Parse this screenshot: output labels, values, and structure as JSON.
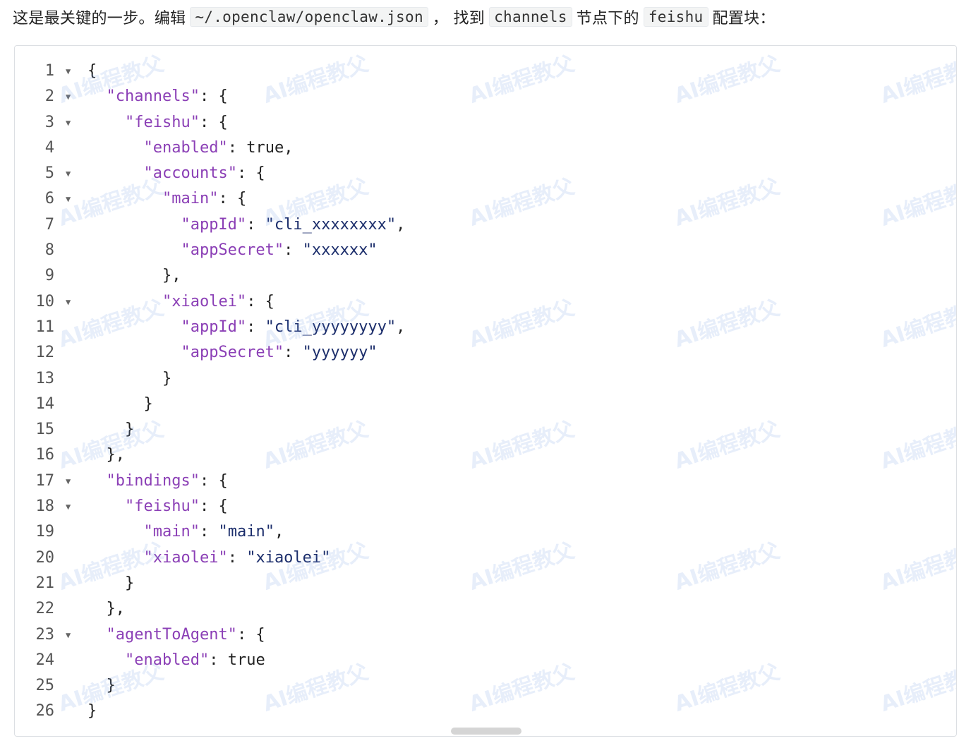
{
  "intro": {
    "before": "这是最关键的一步。编辑",
    "file_path": "~/.openclaw/openclaw.json",
    "middle": "， 找到",
    "channels_word": "channels",
    "middle2": "节点下的",
    "feishu_word": "feishu",
    "after": "配置块："
  },
  "watermark_text": "AI编程教父",
  "code_lines": [
    {
      "num": "1",
      "fold": true,
      "indent": 0,
      "tokens": [
        {
          "t": "punc",
          "v": "{"
        }
      ]
    },
    {
      "num": "2",
      "fold": true,
      "indent": 1,
      "tokens": [
        {
          "t": "key",
          "v": "\"channels\""
        },
        {
          "t": "punc",
          "v": ": {"
        }
      ]
    },
    {
      "num": "3",
      "fold": true,
      "indent": 2,
      "tokens": [
        {
          "t": "key",
          "v": "\"feishu\""
        },
        {
          "t": "punc",
          "v": ": {"
        }
      ]
    },
    {
      "num": "4",
      "fold": false,
      "indent": 3,
      "tokens": [
        {
          "t": "key",
          "v": "\"enabled\""
        },
        {
          "t": "punc",
          "v": ": "
        },
        {
          "t": "lit",
          "v": "true"
        },
        {
          "t": "punc",
          "v": ","
        }
      ]
    },
    {
      "num": "5",
      "fold": true,
      "indent": 3,
      "tokens": [
        {
          "t": "key",
          "v": "\"accounts\""
        },
        {
          "t": "punc",
          "v": ": {"
        }
      ]
    },
    {
      "num": "6",
      "fold": true,
      "indent": 4,
      "tokens": [
        {
          "t": "key",
          "v": "\"main\""
        },
        {
          "t": "punc",
          "v": ": {"
        }
      ]
    },
    {
      "num": "7",
      "fold": false,
      "indent": 5,
      "tokens": [
        {
          "t": "key",
          "v": "\"appId\""
        },
        {
          "t": "punc",
          "v": ": "
        },
        {
          "t": "str",
          "v": "\"cli_xxxxxxxx\""
        },
        {
          "t": "punc",
          "v": ","
        }
      ]
    },
    {
      "num": "8",
      "fold": false,
      "indent": 5,
      "tokens": [
        {
          "t": "key",
          "v": "\"appSecret\""
        },
        {
          "t": "punc",
          "v": ": "
        },
        {
          "t": "str",
          "v": "\"xxxxxx\""
        }
      ]
    },
    {
      "num": "9",
      "fold": false,
      "indent": 4,
      "tokens": [
        {
          "t": "punc",
          "v": "},"
        }
      ]
    },
    {
      "num": "10",
      "fold": true,
      "indent": 4,
      "tokens": [
        {
          "t": "key",
          "v": "\"xiaolei\""
        },
        {
          "t": "punc",
          "v": ": {"
        }
      ]
    },
    {
      "num": "11",
      "fold": false,
      "indent": 5,
      "tokens": [
        {
          "t": "key",
          "v": "\"appId\""
        },
        {
          "t": "punc",
          "v": ": "
        },
        {
          "t": "str",
          "v": "\"cli_yyyyyyyy\""
        },
        {
          "t": "punc",
          "v": ","
        }
      ]
    },
    {
      "num": "12",
      "fold": false,
      "indent": 5,
      "tokens": [
        {
          "t": "key",
          "v": "\"appSecret\""
        },
        {
          "t": "punc",
          "v": ": "
        },
        {
          "t": "str",
          "v": "\"yyyyyy\""
        }
      ]
    },
    {
      "num": "13",
      "fold": false,
      "indent": 4,
      "tokens": [
        {
          "t": "punc",
          "v": "}"
        }
      ]
    },
    {
      "num": "14",
      "fold": false,
      "indent": 3,
      "tokens": [
        {
          "t": "punc",
          "v": "}"
        }
      ]
    },
    {
      "num": "15",
      "fold": false,
      "indent": 2,
      "tokens": [
        {
          "t": "punc",
          "v": "}"
        }
      ]
    },
    {
      "num": "16",
      "fold": false,
      "indent": 1,
      "tokens": [
        {
          "t": "punc",
          "v": "},"
        }
      ]
    },
    {
      "num": "17",
      "fold": true,
      "indent": 1,
      "tokens": [
        {
          "t": "key",
          "v": "\"bindings\""
        },
        {
          "t": "punc",
          "v": ": {"
        }
      ]
    },
    {
      "num": "18",
      "fold": true,
      "indent": 2,
      "tokens": [
        {
          "t": "key",
          "v": "\"feishu\""
        },
        {
          "t": "punc",
          "v": ": {"
        }
      ]
    },
    {
      "num": "19",
      "fold": false,
      "indent": 3,
      "tokens": [
        {
          "t": "key",
          "v": "\"main\""
        },
        {
          "t": "punc",
          "v": ": "
        },
        {
          "t": "str",
          "v": "\"main\""
        },
        {
          "t": "punc",
          "v": ","
        }
      ]
    },
    {
      "num": "20",
      "fold": false,
      "indent": 3,
      "tokens": [
        {
          "t": "key",
          "v": "\"xiaolei\""
        },
        {
          "t": "punc",
          "v": ": "
        },
        {
          "t": "str",
          "v": "\"xiaolei\""
        }
      ]
    },
    {
      "num": "21",
      "fold": false,
      "indent": 2,
      "tokens": [
        {
          "t": "punc",
          "v": "}"
        }
      ]
    },
    {
      "num": "22",
      "fold": false,
      "indent": 1,
      "tokens": [
        {
          "t": "punc",
          "v": "},"
        }
      ]
    },
    {
      "num": "23",
      "fold": true,
      "indent": 1,
      "tokens": [
        {
          "t": "key",
          "v": "\"agentToAgent\""
        },
        {
          "t": "punc",
          "v": ": {"
        }
      ]
    },
    {
      "num": "24",
      "fold": false,
      "indent": 2,
      "tokens": [
        {
          "t": "key",
          "v": "\"enabled\""
        },
        {
          "t": "punc",
          "v": ": "
        },
        {
          "t": "lit",
          "v": "true"
        }
      ]
    },
    {
      "num": "25",
      "fold": false,
      "indent": 1,
      "tokens": [
        {
          "t": "punc",
          "v": "}"
        }
      ]
    },
    {
      "num": "26",
      "fold": false,
      "indent": 0,
      "tokens": [
        {
          "t": "punc",
          "v": "}"
        }
      ]
    }
  ],
  "fold_icon": "caret-down-icon"
}
